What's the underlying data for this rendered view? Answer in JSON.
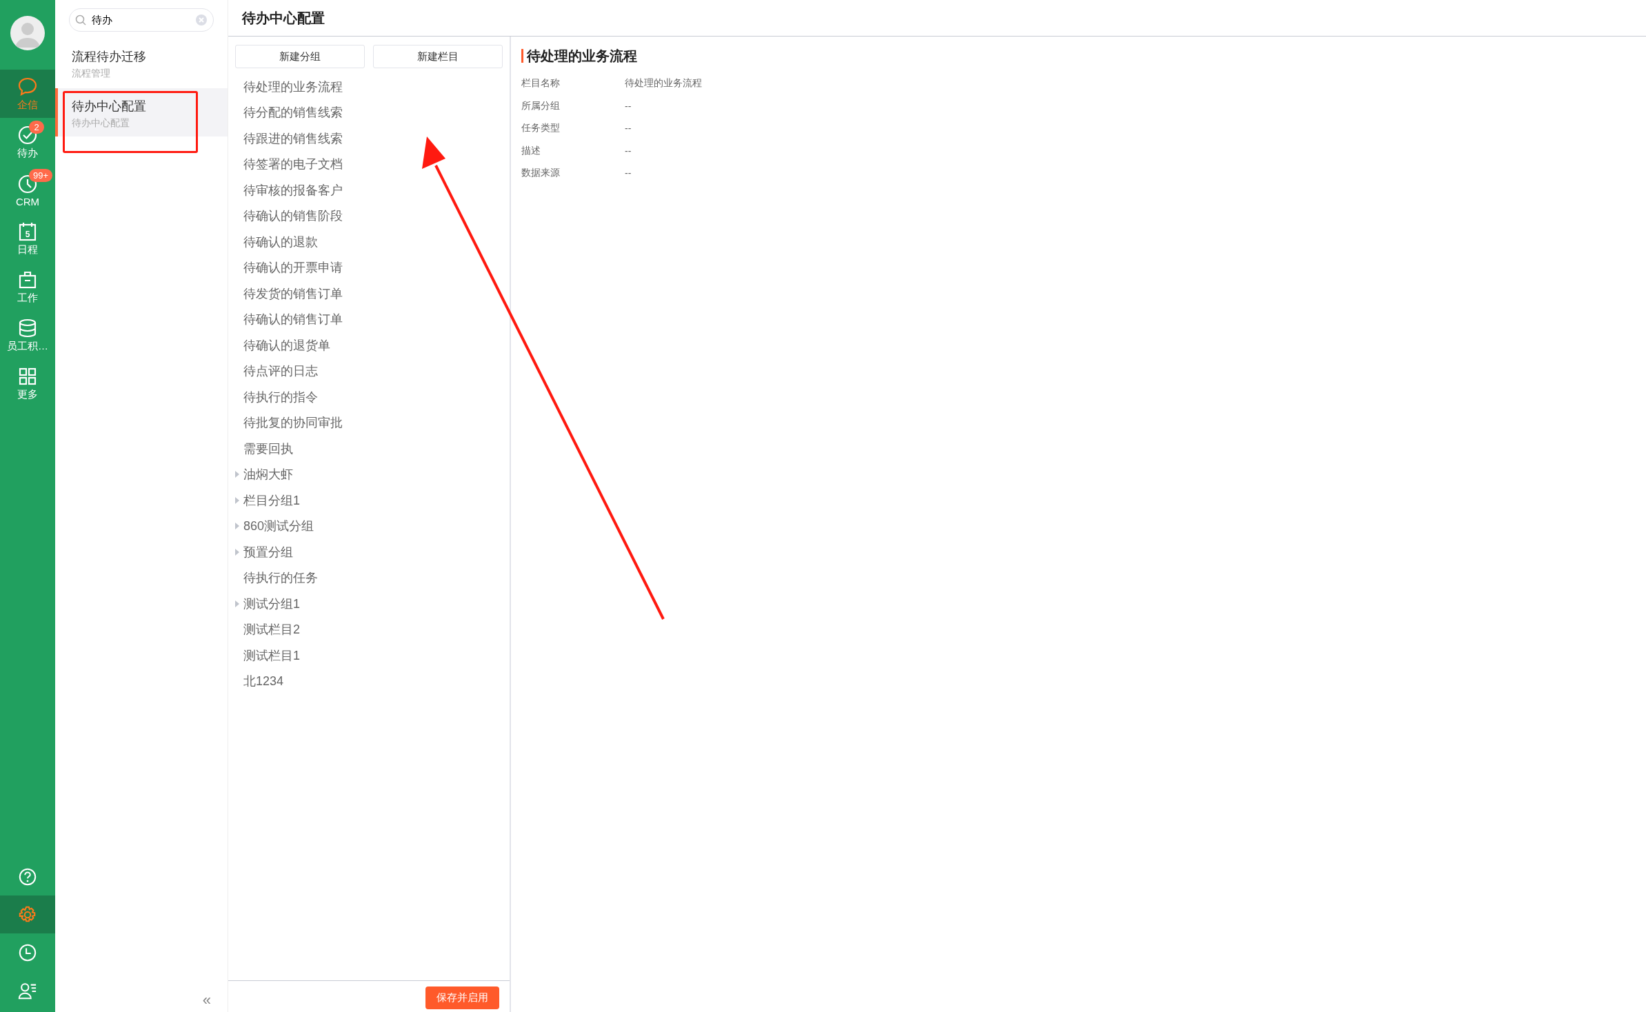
{
  "rail": {
    "nav": [
      {
        "kind": "chat",
        "label": "企信",
        "selected": true
      },
      {
        "kind": "check",
        "label": "待办",
        "selected": false,
        "badge": "2"
      },
      {
        "kind": "clock",
        "label": "CRM",
        "selected": false,
        "badge": "99+"
      },
      {
        "kind": "calendar",
        "label": "日程",
        "selected": false,
        "icon_text": "5"
      },
      {
        "kind": "briefcase",
        "label": "工作",
        "selected": false
      },
      {
        "kind": "database",
        "label": "员工积…",
        "selected": false
      },
      {
        "kind": "grid",
        "label": "更多",
        "selected": false
      }
    ],
    "bottom": [
      {
        "kind": "help",
        "selected": false
      },
      {
        "kind": "gear",
        "selected": true
      },
      {
        "kind": "history",
        "selected": false
      },
      {
        "kind": "contacts",
        "selected": false
      }
    ]
  },
  "menu": {
    "search": {
      "value": "待办"
    },
    "items": [
      {
        "title": "流程待办迁移",
        "subtitle": "流程管理",
        "selected": false
      },
      {
        "title": "待办中心配置",
        "subtitle": "待办中心配置",
        "selected": true
      }
    ],
    "collapse": "«"
  },
  "header": {
    "title": "待办中心配置"
  },
  "tree": {
    "buttons": [
      "新建分组",
      "新建栏目"
    ],
    "items": [
      {
        "kind": "item",
        "label": "待处理的业务流程"
      },
      {
        "kind": "item",
        "label": "待分配的销售线索"
      },
      {
        "kind": "item",
        "label": "待跟进的销售线索"
      },
      {
        "kind": "item",
        "label": "待签署的电子文档"
      },
      {
        "kind": "item",
        "label": "待审核的报备客户"
      },
      {
        "kind": "item",
        "label": "待确认的销售阶段"
      },
      {
        "kind": "item",
        "label": "待确认的退款"
      },
      {
        "kind": "item",
        "label": "待确认的开票申请"
      },
      {
        "kind": "item",
        "label": "待发货的销售订单"
      },
      {
        "kind": "item",
        "label": "待确认的销售订单"
      },
      {
        "kind": "item",
        "label": "待确认的退货单"
      },
      {
        "kind": "item",
        "label": "待点评的日志"
      },
      {
        "kind": "item",
        "label": "待执行的指令"
      },
      {
        "kind": "item",
        "label": "待批复的协同审批"
      },
      {
        "kind": "item",
        "label": "需要回执"
      },
      {
        "kind": "group",
        "label": "油焖大虾",
        "expanded": false
      },
      {
        "kind": "group",
        "label": "栏目分组1",
        "expanded": false
      },
      {
        "kind": "group",
        "label": "860测试分组",
        "expanded": false
      },
      {
        "kind": "group",
        "label": "预置分组",
        "expanded": false
      },
      {
        "kind": "item",
        "label": "待执行的任务"
      },
      {
        "kind": "group",
        "label": "测试分组1",
        "expanded": false
      },
      {
        "kind": "item",
        "label": "测试栏目2"
      },
      {
        "kind": "item",
        "label": "测试栏目1"
      },
      {
        "kind": "item",
        "label": "北1234"
      }
    ],
    "save_button": "保存并启用"
  },
  "details": {
    "title": "待处理的业务流程",
    "fields": [
      {
        "label": "栏目名称",
        "value": "待处理的业务流程"
      },
      {
        "label": "所属分组",
        "value": "--"
      },
      {
        "label": "任务类型",
        "value": "--"
      },
      {
        "label": "描述",
        "value": "--"
      },
      {
        "label": "数据来源",
        "value": "--"
      }
    ]
  },
  "annotations": {
    "highlight_box": true,
    "arrow": true
  }
}
